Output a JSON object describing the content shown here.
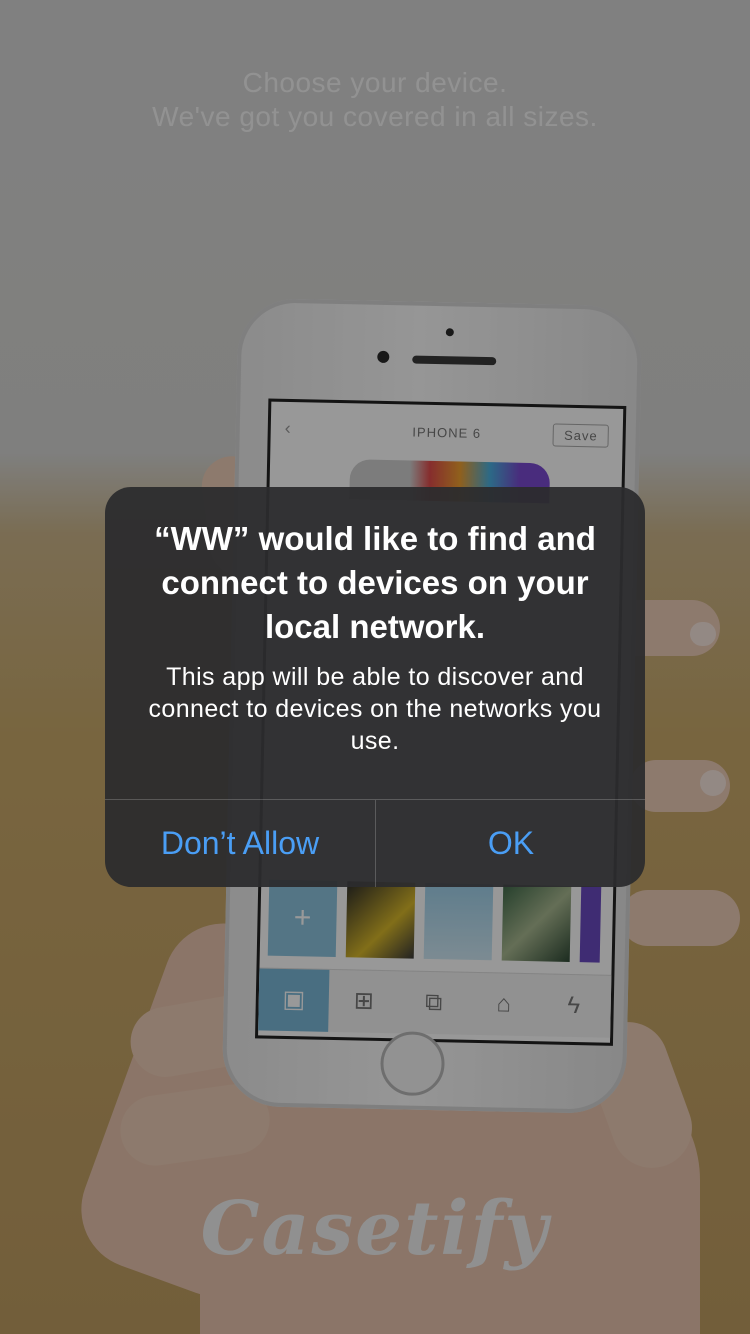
{
  "background": {
    "headline_line1": "Choose your device.",
    "headline_line2": "We've got you covered in all sizes.",
    "logo_text": "Casetify",
    "phone_screen": {
      "back_glyph": "‹",
      "title": "IPHONE 6",
      "save_label": "Save",
      "add_glyph": "+"
    }
  },
  "alert": {
    "title": "“WW” would like to find and connect to devices on your local network.",
    "message": "This app will be able to discover and connect to devices on the networks you use.",
    "buttons": {
      "deny_label": "Don’t Allow",
      "ok_label": "OK"
    }
  },
  "colors": {
    "alert_background": "#2c2c2e",
    "button_text": "#4a9ef5",
    "dim_overlay": "rgba(0,0,0,0.40)"
  }
}
